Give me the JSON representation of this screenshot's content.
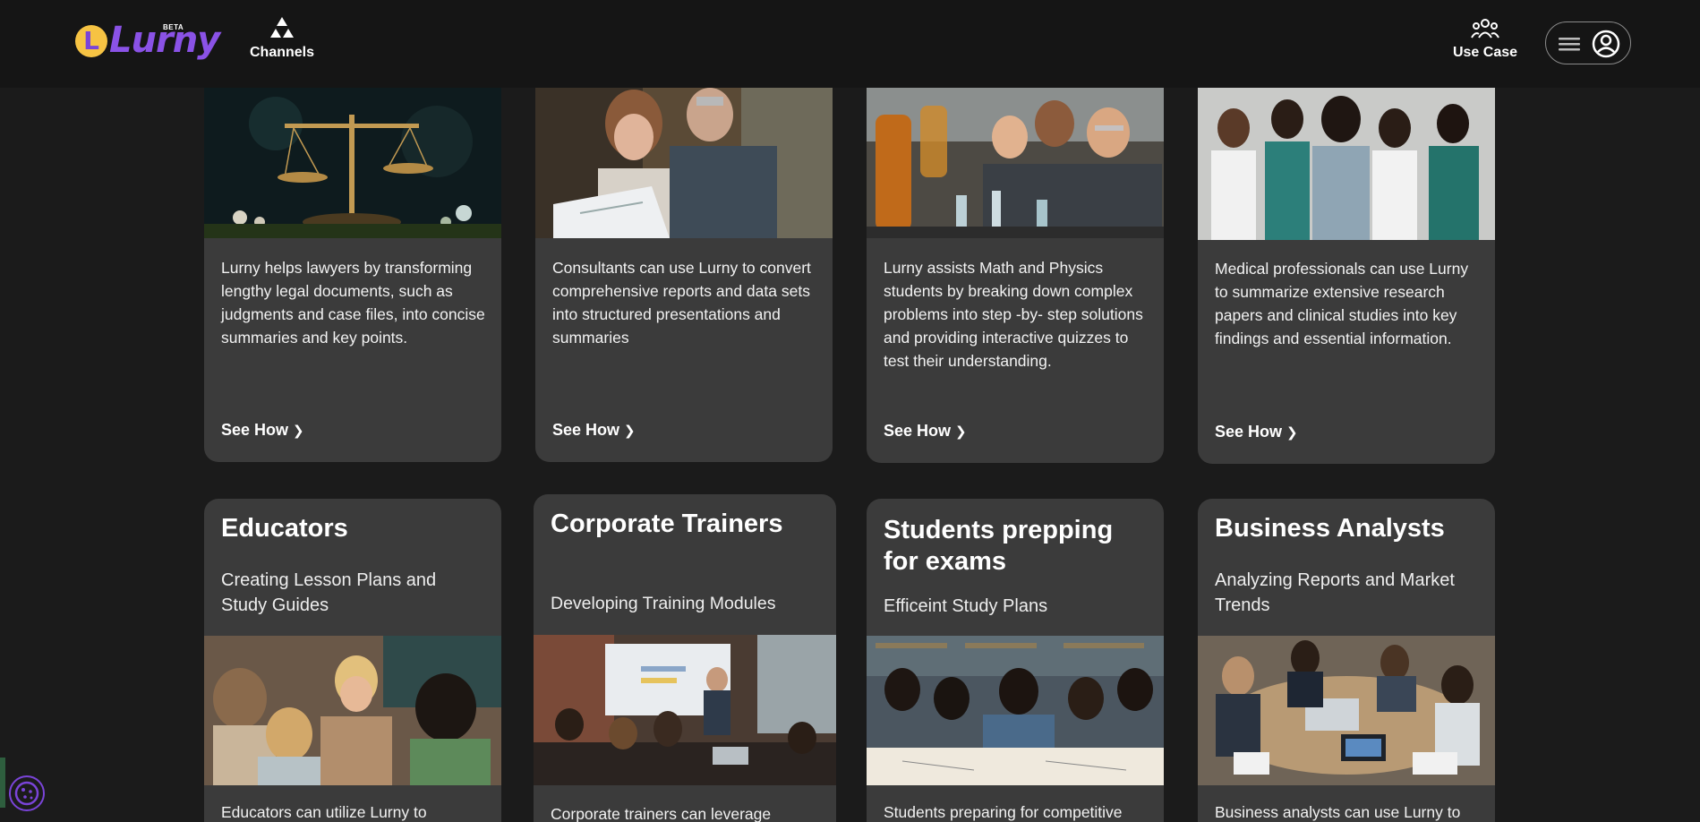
{
  "brand": {
    "name": "Lurny",
    "letter": "L",
    "badge": "BETA"
  },
  "nav": {
    "channels": "Channels",
    "use_case": "Use Case"
  },
  "row1": [
    {
      "description": "Lurny helps lawyers by transforming lengthy legal documents, such as judgments and case files, into concise summaries and key points.",
      "cta": "See How"
    },
    {
      "description": "Consultants can use Lurny to convert comprehensive reports and data sets into structured presentations and summaries",
      "cta": "See How"
    },
    {
      "description": "Lurny assists Math and Physics students by breaking down complex problems into step -by- step solutions and providing interactive quizzes to test their understanding.",
      "cta": "See How"
    },
    {
      "description": "Medical professionals can use Lurny to summarize extensive research papers and clinical studies into key findings and essential information.",
      "cta": "See How"
    }
  ],
  "row2": [
    {
      "title": "Educators",
      "subtitle": "Creating Lesson Plans and Study Guides",
      "description": "Educators can utilize Lurny to"
    },
    {
      "title": "Corporate Trainers",
      "subtitle": "Developing Training Modules",
      "description": "Corporate trainers can leverage"
    },
    {
      "title": "Students prepping for exams",
      "subtitle": "Efficeint Study Plans",
      "description": "Students preparing for competitive"
    },
    {
      "title": "Business Analysts",
      "subtitle": "Analyzing Reports and Market Trends",
      "description": "Business analysts can use Lurny to"
    }
  ],
  "icons": {
    "channels": "triangles-icon",
    "use_case": "group-icon",
    "menu": "hamburger-icon",
    "user": "user-circle-icon",
    "cookie": "cookie-icon",
    "see_how": "chevron-right-icon"
  },
  "colors": {
    "background": "#1b1b1b",
    "card": "#3b3b3b",
    "brand_purple": "#8a52e6",
    "brand_yellow": "#f6c343"
  }
}
